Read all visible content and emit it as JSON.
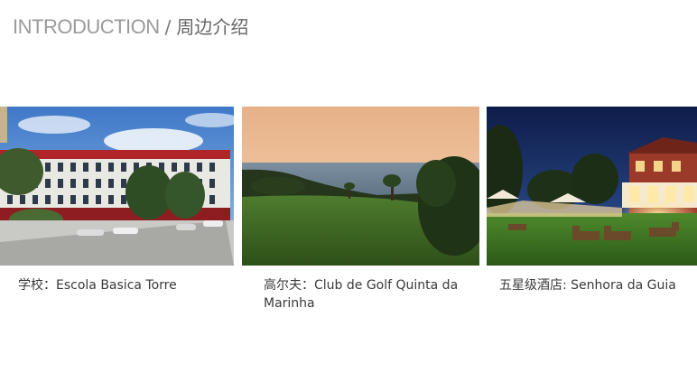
{
  "header": {
    "title_en": "INTRODUCTION",
    "separator": "/",
    "title_cn": "周边介绍"
  },
  "cards": [
    {
      "image_name": "school-photo",
      "caption": "学校：Escola Basica Torre"
    },
    {
      "image_name": "golf-course-photo",
      "caption": "高尔夫：Club de Golf Quinta da Marinha"
    },
    {
      "image_name": "hotel-photo",
      "caption": "五星级酒店: Senhora da Guia"
    }
  ]
}
